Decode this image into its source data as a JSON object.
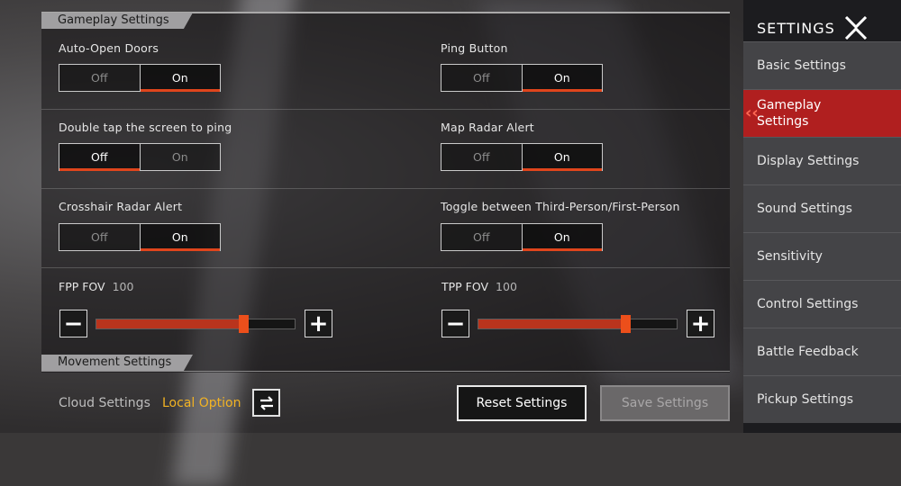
{
  "sections": {
    "gameplay_header": "Gameplay Settings",
    "movement_header": "Movement Settings"
  },
  "settings": [
    {
      "label": "Auto-Open Doors",
      "off": "Off",
      "on": "On",
      "selected": "On"
    },
    {
      "label": "Ping Button",
      "off": "Off",
      "on": "On",
      "selected": "On"
    },
    {
      "label": "Double tap the screen to ping",
      "off": "Off",
      "on": "On",
      "selected": "Off"
    },
    {
      "label": "Map Radar Alert",
      "off": "Off",
      "on": "On",
      "selected": "On"
    },
    {
      "label": "Crosshair Radar Alert",
      "off": "Off",
      "on": "On",
      "selected": "On"
    },
    {
      "label": "Toggle between Third-Person/First-Person",
      "off": "Off",
      "on": "On",
      "selected": "On"
    }
  ],
  "fov": {
    "fpp": {
      "label": "FPP FOV",
      "value": "100",
      "minus": "−",
      "plus": "+",
      "level": 0.74
    },
    "tpp": {
      "label": "TPP FOV",
      "value": "100",
      "minus": "−",
      "plus": "+",
      "level": 0.74
    }
  },
  "footer": {
    "cloud_label": "Cloud Settings",
    "local_option": "Local Option",
    "reset_label": "Reset Settings",
    "save_label": "Save Settings"
  },
  "sidebar": {
    "title": "SETTINGS",
    "items": [
      {
        "label": "Basic Settings",
        "active": false
      },
      {
        "label": "Gameplay Settings",
        "active": true
      },
      {
        "label": "Display Settings",
        "active": false
      },
      {
        "label": "Sound Settings",
        "active": false
      },
      {
        "label": "Sensitivity",
        "active": false
      },
      {
        "label": "Control Settings",
        "active": false
      },
      {
        "label": "Battle Feedback",
        "active": false
      },
      {
        "label": "Pickup Settings",
        "active": false
      }
    ]
  },
  "colors": {
    "accent": "#e0451c",
    "local_option": "#f2b323",
    "sidebar_active": "#b01f1f"
  },
  "icons": {
    "close": "close-x-icon",
    "swap": "swap-arrows-icon",
    "chevron": "chevron-left-icon"
  }
}
